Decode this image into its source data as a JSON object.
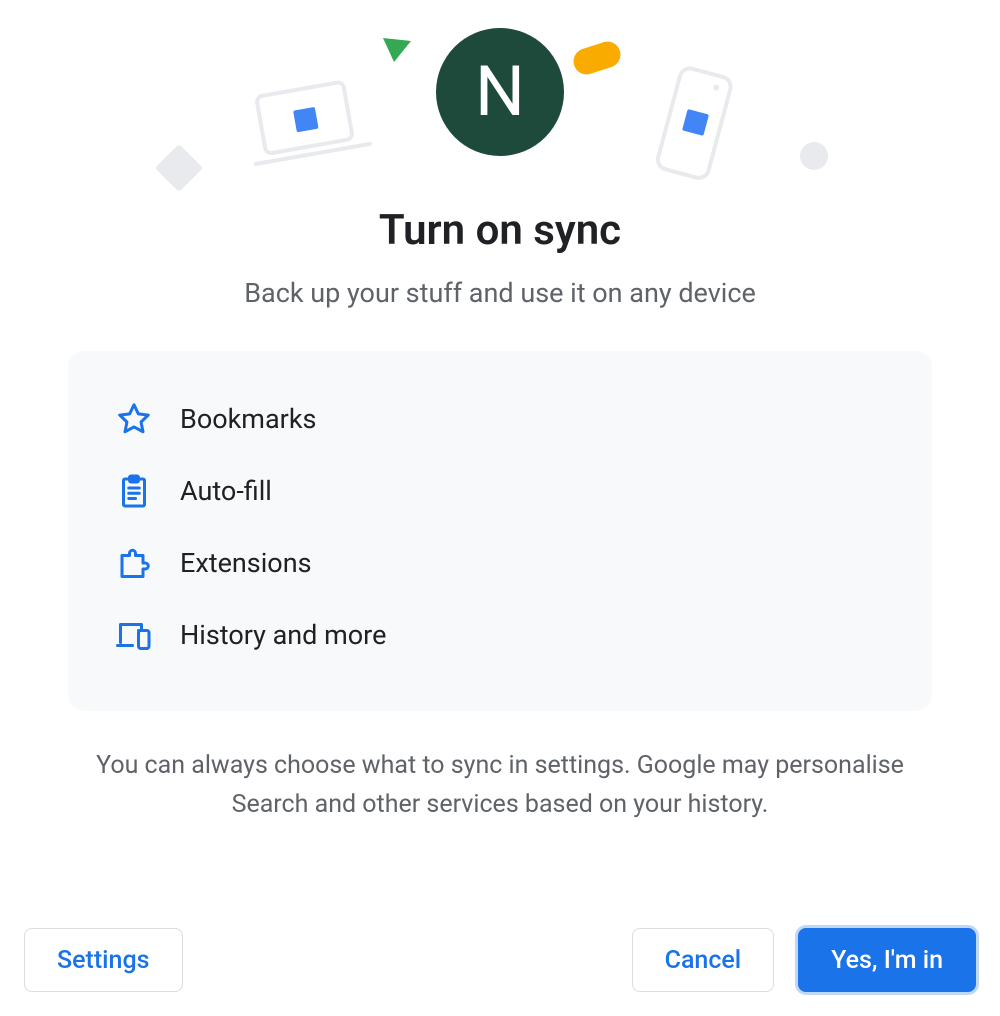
{
  "avatar": {
    "initial": "N",
    "bg_color": "#1d4a3a"
  },
  "title": "Turn on sync",
  "subtitle": "Back up your stuff and use it on any device",
  "sync_items": [
    {
      "icon": "star-icon",
      "label": "Bookmarks"
    },
    {
      "icon": "clipboard-icon",
      "label": "Auto-fill"
    },
    {
      "icon": "puzzle-icon",
      "label": "Extensions"
    },
    {
      "icon": "devices-icon",
      "label": "History and more"
    }
  ],
  "disclaimer": "You can always choose what to sync in settings. Google may personalise Search and other services based on your history.",
  "buttons": {
    "settings": "Settings",
    "cancel": "Cancel",
    "confirm": "Yes, I'm in"
  }
}
